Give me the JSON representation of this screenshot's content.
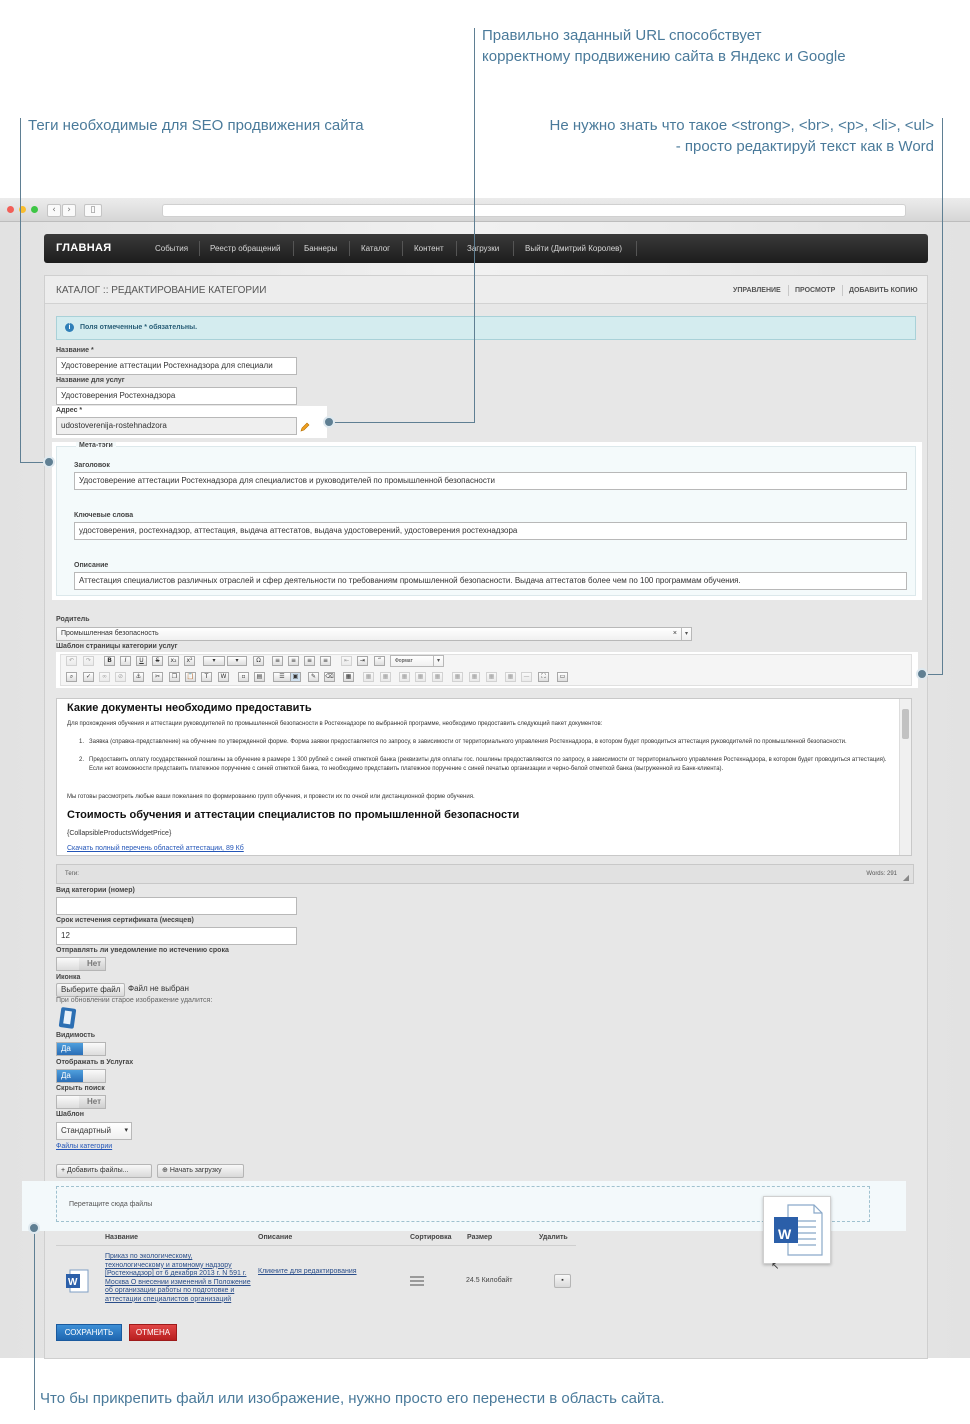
{
  "annotations": {
    "url_note_line1": "Правильно заданный URL способствует",
    "url_note_line2": "корректному продвижению сайта в Яндекс и Google",
    "tags_note": "Теги необходимые для SEO продвижения сайта",
    "editor_note_line1": "Не нужно знать что такое <strong>, <br>, <p>, <li>, <ul>",
    "editor_note_line2": "- просто редактируй текст как в Word",
    "drop_note": "Что бы прикрепить файл или изображение, нужно просто его перенести в область сайта."
  },
  "topnav": {
    "brand": "ГЛАВНАЯ",
    "items": [
      "События",
      "Реестр обращений",
      "Баннеры",
      "Каталог",
      "Контент",
      "Загрузки",
      "Выйти (Дмитрий Королев)"
    ]
  },
  "page": {
    "title": "КАТАЛОГ :: РЕДАКТИРОВАНИЕ КАТЕГОРИИ",
    "header_links": [
      "УПРАВЛЕНИЕ",
      "ПРОСМОТР",
      "ДОБАВИТЬ КОПИЮ"
    ],
    "notice": "Поля отмеченные * обязательны."
  },
  "form": {
    "name_label": "Название *",
    "name_value": "Удостоверение аттестации Ростехнадзора для специали",
    "service_name_label": "Название для услуг",
    "service_name_value": "Удостоверения Ростехнадзора",
    "address_label": "Адрес *",
    "address_value": "udostoverenija-rostehnadzora",
    "meta_legend": "Мета-тэги",
    "meta_title_label": "Заголовок",
    "meta_title_value": "Удостоверение аттестации Ростехнадзора для специалистов и руководителей по промышленной безопасности",
    "meta_keywords_label": "Ключевые слова",
    "meta_keywords_value": "удостоверения, ростехнадзор, аттестация, выдача аттестатов, выдача удостоверений, удостоверения ростехнадзора",
    "meta_description_label": "Описание",
    "meta_description_value": "Аттестация специалистов различных отраслей и сфер деятельности по требованиям промышленной безопасности. Выдача аттестатов более чем по 100 программам обучения.",
    "parent_label": "Родитель",
    "parent_value": "Промышленная безопасность",
    "template_label": "Шаблон страницы категории услуг",
    "format_label": "Формат"
  },
  "editor": {
    "heading1": "Какие документы необходимо предоставить",
    "intro": "Для прохождения обучения и аттестации руководителей по промышленной безопасности в Ростехнадзоре по выбранной программе, необходимо предоставить следующий пакет документов:",
    "item1": "Заявка (справка-представление) на обучение по утвержденной форме. Форма заявки предоставляется по запросу, в зависимости от территориального управления Ростехнадзора, в котором будет проводиться аттестация руководителей по промышленной безопасности.",
    "item2": "Предоставить оплату государственной пошлины за обучение в размере 1 300 рублей с синей отметкой банка (реквизиты для оплаты гос. пошлины предоставляются по запросу, в зависимости от территориального управления Ростехнадзора, в котором будет проводиться аттестация). Если нет возможности представить платежное поручение с синей отметкой банка, то необходимо представить платежное поручение с синей печатью организации и черно-белой отметкой банка (выгруженной из Банк-клиента).",
    "ready": "Мы готовы рассмотреть любые ваши пожелания по формированию групп обучения, и провести их по очной или дистанционной форме обучения.",
    "heading2": "Стоимость обучения и аттестации специалистов по промышленной безопасности",
    "widget": "{CollapsibleProductsWidgetPrice}",
    "download_link": "Скачать полный перечень областей аттестации, 89 Кб",
    "tags_label": "Теги:",
    "words_label": "Words: 291"
  },
  "fields2": {
    "category_type_label": "Вид категории (номер)",
    "category_type_value": "",
    "cert_expiry_label": "Срок истечения сертификата (месяцев)",
    "cert_expiry_value": "12",
    "notify_label": "Отправлять ли уведомление по истечению срока",
    "notify_value": "Нет",
    "icon_label": "Иконка",
    "choose_file_button": "Выберите файл",
    "no_file_text": "Файл не выбран",
    "replace_note": "При обновлении старое изображение удалится:",
    "visibility_label": "Видимость",
    "visibility_value": "Да",
    "show_in_services_label": "Отображать в Услугах",
    "show_in_services_value": "Да",
    "hide_search_label": "Скрыть поиск",
    "hide_search_value": "Нет",
    "template_select_label": "Шаблон",
    "template_select_value": "Стандартный",
    "category_files_link": "Файлы категории"
  },
  "upload": {
    "add_files_button": "Добавить файлы...",
    "start_upload_button": "Начать загрузку",
    "drop_text": "Перетащите сюда файлы",
    "col_name": "Название",
    "col_description": "Описание",
    "col_sort": "Сортировка",
    "col_size": "Размер",
    "col_delete": "Удалить",
    "file_name": "Приказ по экологическому, технологическому и атомному надзору [Ростехнадзор] от 6 декабря 2013 г. N 591 г. Москва О внесении изменений в Положение об организации работы по подготовке и аттестации специалистов организаций",
    "file_description": "Кликните для редактирования",
    "file_size": "24.5 Килобайт",
    "word_letter": "W"
  },
  "actions": {
    "save": "СОХРАНИТЬ",
    "cancel": "ОТМЕНА"
  },
  "colors": {
    "annotation": "#4a7a9a",
    "primary_button": "#2a78c4",
    "cancel_button": "#cc2b2b",
    "navbar": "#2a2a2a"
  }
}
